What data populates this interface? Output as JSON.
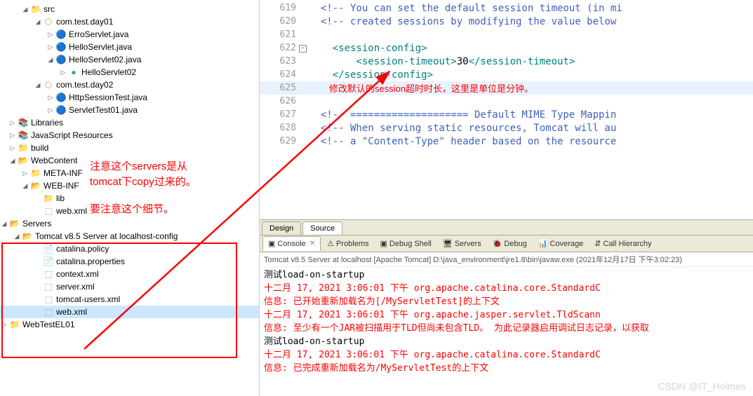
{
  "tree": {
    "src": "src",
    "pkg_day01": "com.test.day01",
    "erroServlet": "ErroServlet.java",
    "helloServlet": "HelloServlet.java",
    "helloServlet02": "HelloServlet02.java",
    "helloServlet02Class": "HelloServlet02",
    "pkg_day02": "com.test.day02",
    "httpSessionTest": "HttpSessionTest.java",
    "servletTest01": "ServletTest01.java",
    "libraries": "Libraries",
    "jsResources": "JavaScript Resources",
    "build": "build",
    "webContent": "WebContent",
    "metaInf": "META-INF",
    "webInf": "WEB-INF",
    "lib": "lib",
    "webXml": "web.xml",
    "servers": "Servers",
    "tomcatConfig": "Tomcat v8.5 Server at localhost-config",
    "catalinaPolicy": "catalina.policy",
    "catalinaProps": "catalina.properties",
    "contextXml": "context.xml",
    "serverXml": "server.xml",
    "tomcatUsersXml": "tomcat-users.xml",
    "webXml2": "web.xml",
    "webTestEL01": "WebTestEL01"
  },
  "annotations": {
    "note1_l1": "注意这个servers是从",
    "note1_l2": "tomcat下copy过来的。",
    "note1_l3": "要注意这个细节。",
    "note2": "修改默认的session超时时长，这里是单位是分钟。"
  },
  "editor": {
    "lines": [
      {
        "n": "619",
        "cls": "c-comment",
        "txt": "  <!-- You can set the default session timeout (in mi"
      },
      {
        "n": "620",
        "cls": "c-comment",
        "txt": "  <!-- created sessions by modifying the value below"
      },
      {
        "n": "621",
        "cls": "",
        "txt": ""
      },
      {
        "n": "622",
        "cls": "c-tag",
        "txt": "    <session-config>",
        "fold": true
      },
      {
        "n": "623",
        "cls": "c-tag",
        "txt": "        <session-timeout>",
        "suffix_text": "30",
        "suffix_tag": "</session-timeout>"
      },
      {
        "n": "624",
        "cls": "c-tag",
        "txt": "    </session-config>"
      },
      {
        "n": "625",
        "cls": "c-annotation",
        "txt": "",
        "hl": true
      },
      {
        "n": "626",
        "cls": "",
        "txt": ""
      },
      {
        "n": "627",
        "cls": "c-comment",
        "txt": "  <!-- ==================== Default MIME Type Mappin"
      },
      {
        "n": "628",
        "cls": "c-comment",
        "txt": "  <!-- When serving static resources, Tomcat will au"
      },
      {
        "n": "629",
        "cls": "c-comment",
        "txt": "  <!-- a \"Content-Type\" header based on the resource"
      }
    ]
  },
  "editorTabs": {
    "design": "Design",
    "source": "Source"
  },
  "consoleTabs": {
    "console": "Console",
    "problems": "Problems",
    "debugShell": "Debug Shell",
    "servers": "Servers",
    "debug": "Debug",
    "coverage": "Coverage",
    "callHierarchy": "Call Hierarchy"
  },
  "consoleHeader": "Tomcat v8.5 Server at localhost [Apache Tomcat] D:\\java_environment\\jre1.8\\bin\\javaw.exe (2021年12月17日 下午3:02:23)",
  "consoleLines": [
    {
      "cls": "black",
      "txt": "测试load-on-startup"
    },
    {
      "cls": "red",
      "txt": "十二月 17, 2021 3:06:01 下午 org.apache.catalina.core.StandardC"
    },
    {
      "cls": "red",
      "txt": "信息:  已开始重新加载名为[/MyServletTest]的上下文"
    },
    {
      "cls": "red",
      "txt": "十二月 17, 2021 3:06:01 下午 org.apache.jasper.servlet.TldScann"
    },
    {
      "cls": "red",
      "txt": "信息:  至少有一个JAR被扫描用于TLD但尚未包含TLD。 为此记录器启用调试日志记录，以获取"
    },
    {
      "cls": "black",
      "txt": "测试load-on-startup"
    },
    {
      "cls": "red",
      "txt": "十二月 17, 2021 3:06:01 下午 org.apache.catalina.core.StandardC"
    },
    {
      "cls": "red",
      "txt": "信息:  已完成重新加载名为/MyServletTest的上下文"
    }
  ],
  "watermark": "CSDN @IT_Holmes"
}
